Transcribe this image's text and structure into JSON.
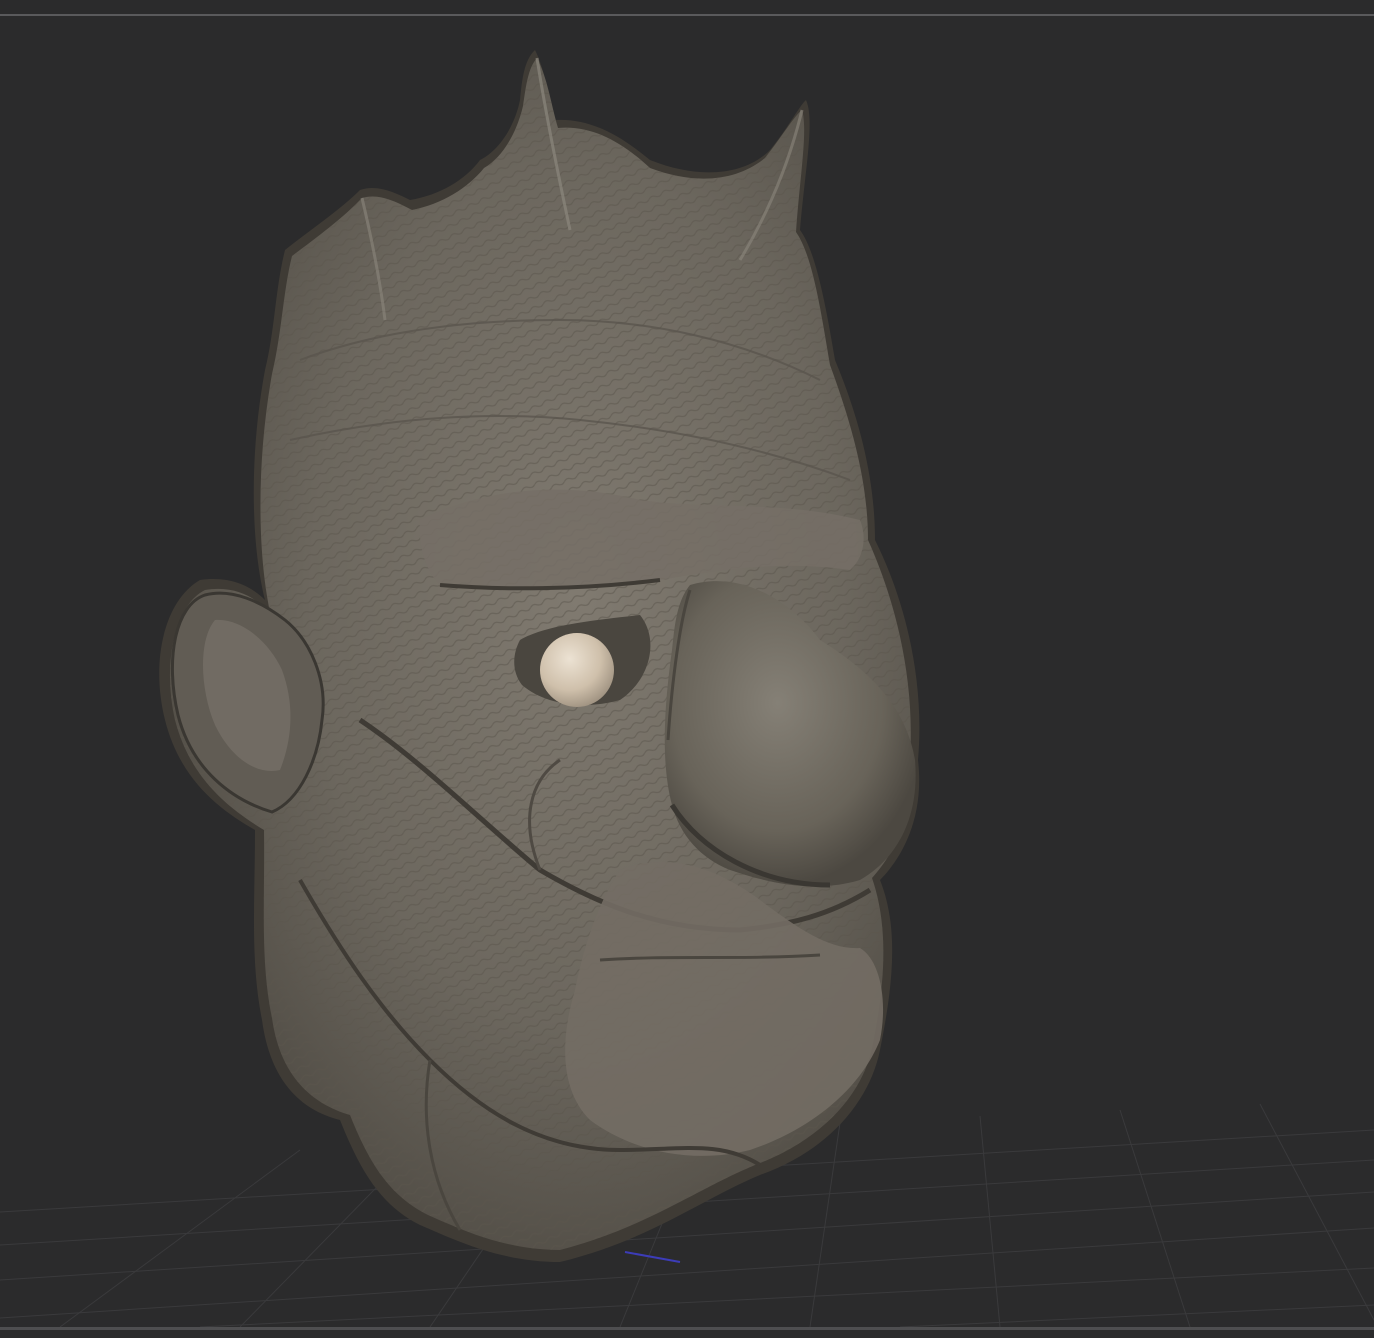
{
  "app": {
    "background_color": "#2b2b2c",
    "rule_color": "#5a5a5c"
  },
  "viewport": {
    "grid_visible": true,
    "grid_color": "#3a3a3c",
    "axis_indicator_color": "#3c3cb8"
  },
  "model": {
    "icon": "sculpted-head-mesh",
    "base_color": "#6f6a61",
    "shadow_color": "#3f3b35",
    "highlight_color": "#8a857b",
    "eye_color": "#d7c9b6"
  }
}
